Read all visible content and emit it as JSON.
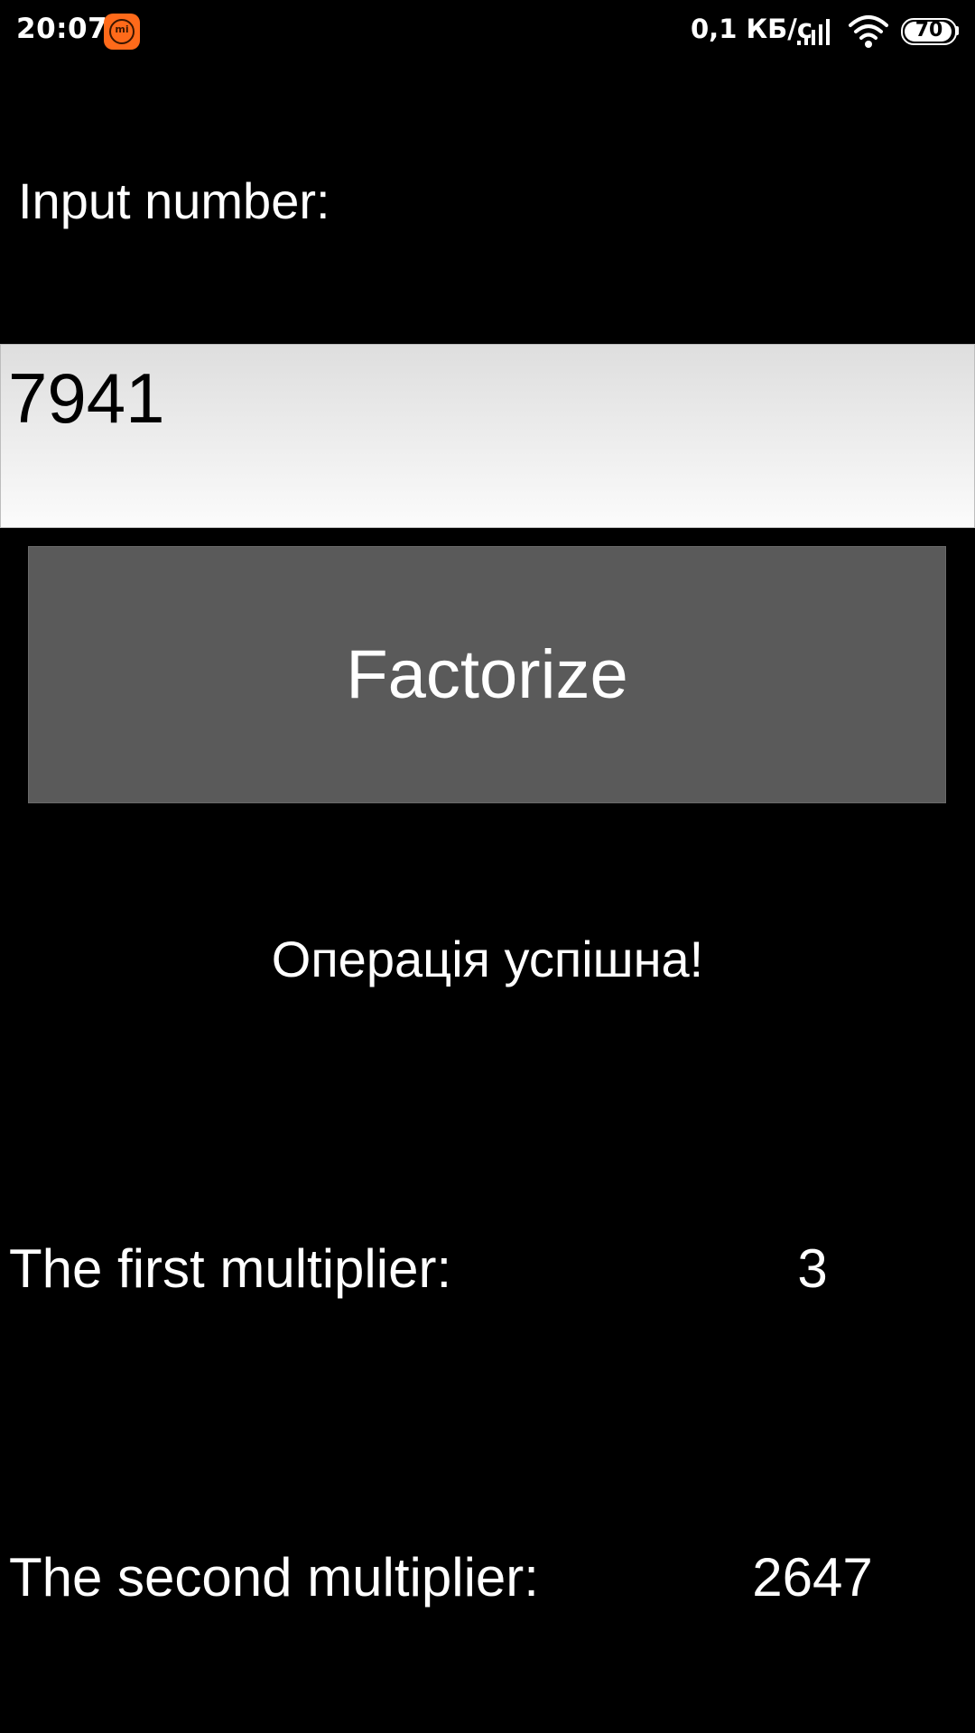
{
  "status_bar": {
    "time": "20:07",
    "notification_icon": "mi-icon",
    "notification_text": "mi",
    "net_speed": "0,1 КБ/с",
    "signal_icon": "signal-icon",
    "wifi_icon": "wifi-icon",
    "battery_level": "70"
  },
  "form": {
    "input_label": "Input number:",
    "input_value": "7941",
    "button_label": "Factorize"
  },
  "result": {
    "status": "Операція успішна!",
    "first_label": "The first multiplier:",
    "first_value": "3",
    "second_label": "The second multiplier:",
    "second_value": "2647"
  },
  "colors": {
    "background": "#000000",
    "button": "#5a5a5a",
    "mi_accent": "#ff6a1a"
  }
}
